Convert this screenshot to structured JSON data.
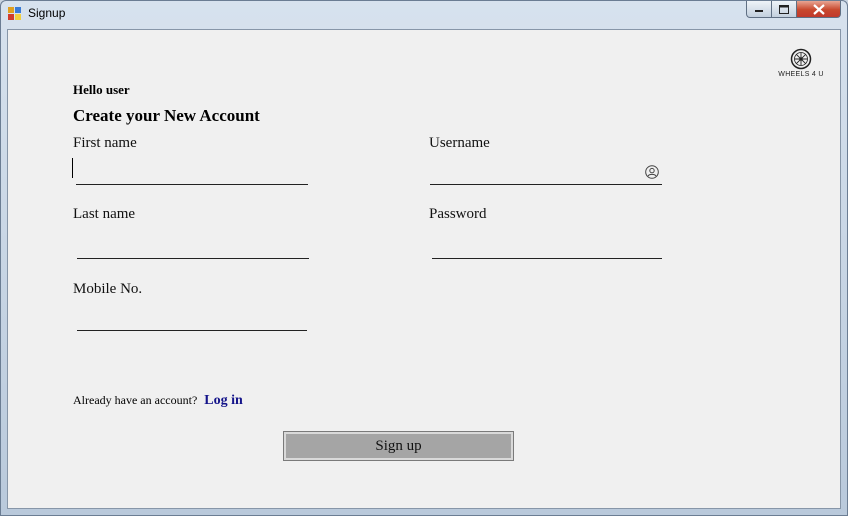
{
  "window": {
    "title": "Signup"
  },
  "logo": {
    "text": "WHEELS 4 U"
  },
  "form": {
    "greeting": "Hello user",
    "heading": "Create your New Account",
    "first_name_label": "First name",
    "first_name_value": "",
    "username_label": "Username",
    "username_value": "",
    "last_name_label": "Last name",
    "last_name_value": "",
    "password_label": "Password",
    "password_value": "",
    "mobile_label": "Mobile No.",
    "mobile_value": ""
  },
  "footer": {
    "prompt": "Already have an account?",
    "login_link": "Log in",
    "signup_label": "Sign up"
  },
  "colors": {
    "link": "#14148a",
    "button": "#a5a5a5",
    "background": "#f0f0f0"
  }
}
